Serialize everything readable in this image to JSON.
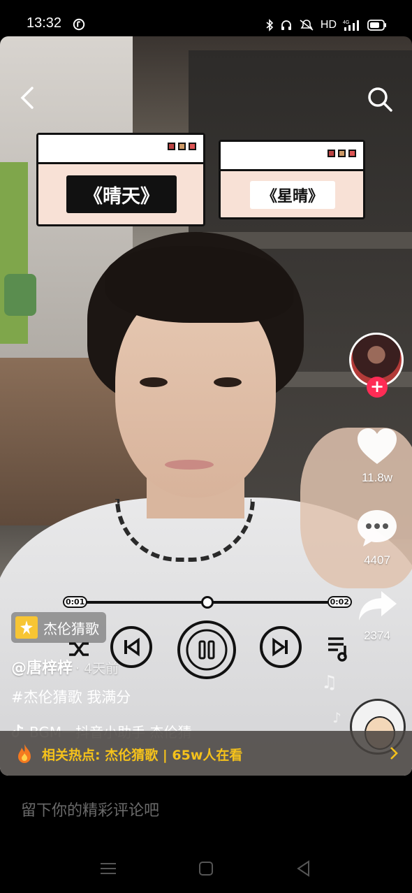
{
  "status_bar": {
    "time": "13:32",
    "hd": "HD",
    "network": "4G",
    "icons": [
      "tiktok-status-icon",
      "bluetooth-icon",
      "headphones-icon",
      "mute-icon",
      "signal-icon",
      "battery-icon"
    ]
  },
  "top_nav": {
    "back_icon": "chevron-left-icon",
    "search_icon": "search-icon"
  },
  "song_cards": [
    {
      "title": "《晴天》"
    },
    {
      "title": "《星晴》"
    }
  ],
  "player": {
    "time_start": "0:01",
    "time_end": "0:02",
    "progress": 0.5
  },
  "rail": {
    "likes": "11.8w",
    "comments": "4407",
    "shares": "2374"
  },
  "post": {
    "topic_tag": "杰伦猜歌",
    "author": "@唐梓梓",
    "time_ago": "· 4天前",
    "caption": "#杰伦猜歌 我满分",
    "music": "BGM一抖音小助手   杰伦猜"
  },
  "hot_bar": {
    "text": "相关热点: 杰伦猜歌 | 65w人在看"
  },
  "comment_bar": {
    "placeholder": "留下你的精彩评论吧"
  },
  "colors": {
    "accent_red": "#fe2c55",
    "hot_yellow": "#f5c21b",
    "tag_yellow": "#f7c534"
  }
}
